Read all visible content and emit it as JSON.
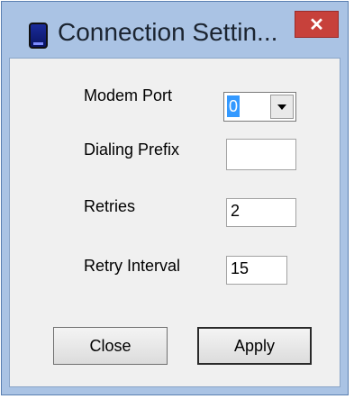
{
  "window": {
    "title": "Connection Settin...",
    "close_glyph": "✕",
    "icon": "modem-icon"
  },
  "form": {
    "modem_port": {
      "label": "Modem Port",
      "value": "0"
    },
    "dialing_prefix": {
      "label": "Dialing Prefix",
      "value": ""
    },
    "retries": {
      "label": "Retries",
      "value": "2"
    },
    "retry_interval": {
      "label": "Retry Interval",
      "value": "15"
    }
  },
  "buttons": {
    "close_label": "Close",
    "apply_label": "Apply"
  },
  "colors": {
    "frame": "#aac3e4",
    "close_button": "#c7413b",
    "selection": "#3399ff"
  }
}
